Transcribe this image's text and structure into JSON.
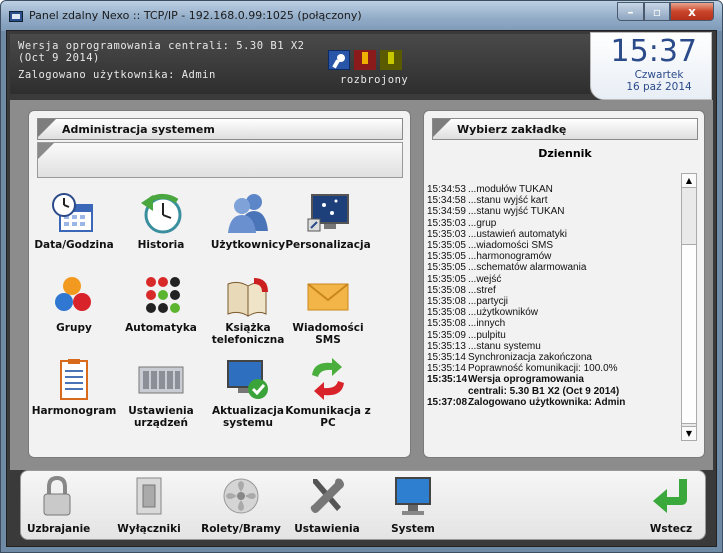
{
  "window": {
    "title": "Panel zdalny Nexo :: TCP/IP - 192.168.0.99:1025 (połączony)",
    "min": "–",
    "max": "▫",
    "close": "x"
  },
  "header": {
    "version": "Wersja oprogramowania centrali: 5.30 B1 X2",
    "version_date": "(Oct  9 2014)",
    "login": "Zalogowano użytkownika: Admin",
    "status": "rozbrojony",
    "icons": [
      "key-icon",
      "alarm-icon",
      "warning-icon"
    ]
  },
  "clock": {
    "time": "15:37",
    "day": "Czwartek",
    "date": "16 paź 2014"
  },
  "left_panel": {
    "title": "Administracja systemem",
    "items": [
      {
        "label": "Data/Godzina",
        "icon": "calendar-clock-icon"
      },
      {
        "label": "Historia",
        "icon": "history-clock-icon"
      },
      {
        "label": "Użytkownicy",
        "icon": "users-icon"
      },
      {
        "label": "Personalizacja",
        "icon": "monitor-icon"
      },
      {
        "label": "Grupy",
        "icon": "groups-icon"
      },
      {
        "label": "Automatyka",
        "icon": "automation-dots-icon"
      },
      {
        "label": "Książka telefoniczna",
        "icon": "phonebook-icon"
      },
      {
        "label": "Wiadomości SMS",
        "icon": "envelope-icon"
      },
      {
        "label": "Harmonogram",
        "icon": "schedule-clipboard-icon"
      },
      {
        "label": "Ustawienia urządzeń",
        "icon": "device-board-icon"
      },
      {
        "label": "Aktualizacja systemu",
        "icon": "update-monitor-icon"
      },
      {
        "label": "Komunikacja z PC",
        "icon": "sync-arrows-icon"
      }
    ]
  },
  "right_panel": {
    "title": "Wybierz zakładkę",
    "log_title": "Dziennik",
    "log": [
      {
        "t": "15:34:53",
        "m": "...modułów TUKAN"
      },
      {
        "t": "15:34:58",
        "m": "...stanu wyjść kart"
      },
      {
        "t": "15:34:59",
        "m": "...stanu wyjść TUKAN"
      },
      {
        "t": "15:35:03",
        "m": "...grup"
      },
      {
        "t": "15:35:03",
        "m": "...ustawień automatyki"
      },
      {
        "t": "15:35:05",
        "m": "...wiadomości SMS"
      },
      {
        "t": "15:35:05",
        "m": "...harmonogramów"
      },
      {
        "t": "15:35:05",
        "m": "...schematów alarmowania"
      },
      {
        "t": "15:35:05",
        "m": "...wejść"
      },
      {
        "t": "15:35:08",
        "m": "...stref"
      },
      {
        "t": "15:35:08",
        "m": "...partycji"
      },
      {
        "t": "15:35:08",
        "m": "...użytkowników"
      },
      {
        "t": "15:35:08",
        "m": "...innych"
      },
      {
        "t": "15:35:09",
        "m": "...pulpitu"
      },
      {
        "t": "15:35:13",
        "m": "...stanu systemu"
      },
      {
        "t": "15:35:14",
        "m": "Synchronizacja zakończona"
      },
      {
        "t": "15:35:14",
        "m": "Poprawność komunikacji: 100.0%"
      },
      {
        "t": "15:35:14",
        "m": "Wersja oprogramowania",
        "bold": true
      },
      {
        "t": "",
        "m": "centrali: 5.30 B1 X2 (Oct  9 2014)",
        "bold": true
      },
      {
        "t": "15:37:08",
        "m": "Zalogowano użytkownika: Admin",
        "bold": true
      }
    ],
    "scroll_up": "▲",
    "scroll_down": "▼"
  },
  "bottom_bar": {
    "items": [
      {
        "label": "Uzbrajanie",
        "icon": "padlock-icon"
      },
      {
        "label": "Wyłączniki",
        "icon": "switch-icon"
      },
      {
        "label": "Rolety/Bramy",
        "icon": "fan-icon"
      },
      {
        "label": "Ustawienia",
        "icon": "tools-icon"
      },
      {
        "label": "System",
        "icon": "computer-icon"
      },
      {
        "label": "Wstecz",
        "icon": "back-arrow-icon"
      }
    ]
  }
}
